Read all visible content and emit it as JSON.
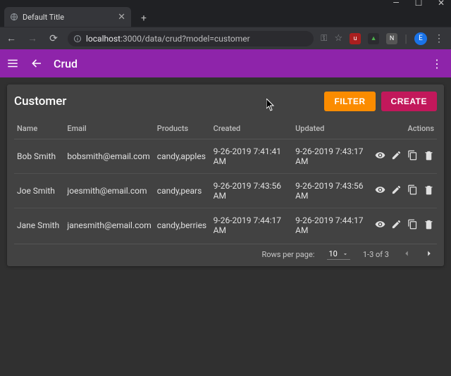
{
  "browser": {
    "tab_title": "Default Title",
    "url_host": "localhost",
    "url_port_path": ":3000/data/crud?model=customer",
    "avatar_letter": "E",
    "ext_n": "N"
  },
  "app": {
    "title": "Crud"
  },
  "card": {
    "title": "Customer",
    "filter_label": "FILTER",
    "create_label": "CREATE"
  },
  "columns": {
    "name": "Name",
    "email": "Email",
    "products": "Products",
    "created": "Created",
    "updated": "Updated",
    "actions": "Actions"
  },
  "rows": [
    {
      "name": "Bob Smith",
      "email": "bobsmith@email.com",
      "products": "candy,apples",
      "created": "9-26-2019 7:41:41 AM",
      "updated": "9-26-2019 7:43:17 AM"
    },
    {
      "name": "Joe Smith",
      "email": "joesmith@email.com",
      "products": "candy,pears",
      "created": "9-26-2019 7:43:56 AM",
      "updated": "9-26-2019 7:43:56 AM"
    },
    {
      "name": "Jane Smith",
      "email": "janesmith@email.com",
      "products": "candy,berries",
      "created": "9-26-2019 7:44:17 AM",
      "updated": "9-26-2019 7:44:17 AM"
    }
  ],
  "footer": {
    "rows_per_page_label": "Rows per page:",
    "rows_per_page_value": "10",
    "range": "1-3 of 3"
  }
}
